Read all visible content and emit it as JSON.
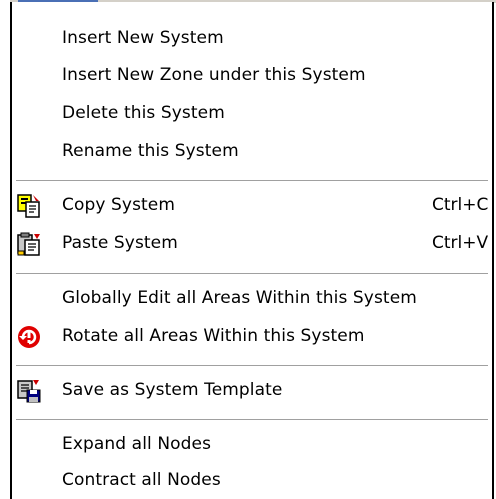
{
  "menu": {
    "items": [
      {
        "label": "Insert New System"
      },
      {
        "label": "Insert New Zone under this System"
      },
      {
        "label": "Delete this System"
      },
      {
        "label": "Rename this System"
      },
      {
        "label": "Copy System",
        "shortcut": "Ctrl+C",
        "icon": "copy-system-icon"
      },
      {
        "label": "Paste System",
        "shortcut": "Ctrl+V",
        "icon": "paste-system-icon"
      },
      {
        "label": "Globally Edit all Areas Within this System"
      },
      {
        "label": "Rotate all Areas Within this System",
        "icon": "rotate-icon"
      },
      {
        "label": "Save as System Template",
        "icon": "save-template-icon"
      },
      {
        "label": "Expand all Nodes"
      },
      {
        "label": "Contract all Nodes"
      }
    ]
  },
  "colors": {
    "separator": "#a0a0a0",
    "rotate_icon": "#e00000",
    "border": "#000000"
  }
}
